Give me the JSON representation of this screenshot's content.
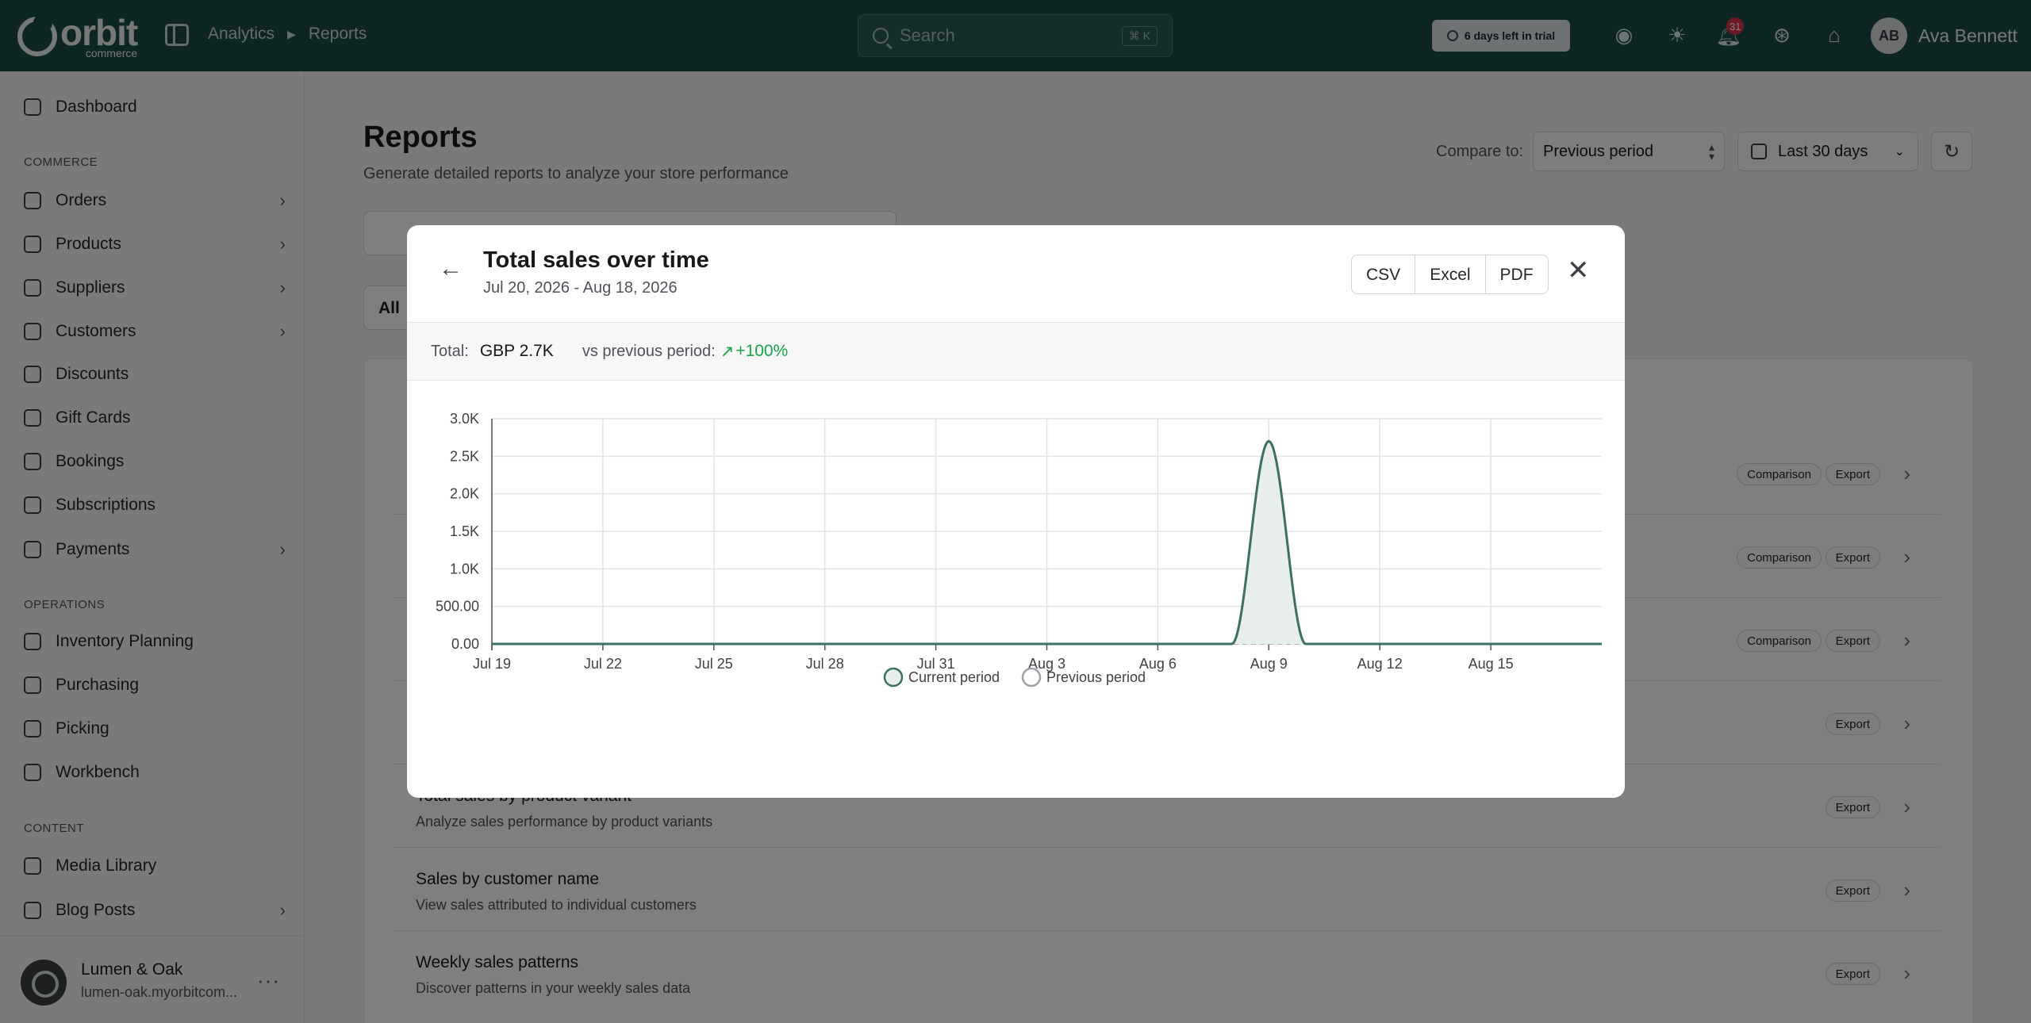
{
  "topbar": {
    "brand": "orbit",
    "brand_sub": "commerce",
    "breadcrumbs": [
      "Analytics",
      "Reports"
    ],
    "search_placeholder": "Search",
    "search_shortcut": "⌘ K",
    "trial_text": "6 days left in trial",
    "notification_count": "31",
    "user_initials": "AB",
    "user_name": "Ava Bennett"
  },
  "sidebar": {
    "dashboard": "Dashboard",
    "commerce_heading": "COMMERCE",
    "orders": "Orders",
    "products": "Products",
    "suppliers": "Suppliers",
    "customers": "Customers",
    "discounts": "Discounts",
    "gift_cards": "Gift Cards",
    "bookings": "Bookings",
    "subscriptions": "Subscriptions",
    "payments": "Payments",
    "operations_heading": "OPERATIONS",
    "inventory_planning": "Inventory Planning",
    "purchasing": "Purchasing",
    "picking": "Picking",
    "workbench": "Workbench",
    "content_heading": "CONTENT",
    "media_library": "Media Library",
    "blog_posts": "Blog Posts",
    "store_name": "Lumen & Oak",
    "store_url": "lumen-oak.myorbitcom..."
  },
  "page": {
    "title": "Reports",
    "subtitle": "Generate detailed reports to analyze your store performance",
    "compare_label": "Compare to:",
    "compare_value": "Previous period",
    "date_range": "Last 30 days",
    "filter_label": "All",
    "rows": [
      {
        "title": "",
        "desc": "",
        "tags": [
          "Comparison",
          "Export"
        ]
      },
      {
        "title": "",
        "desc": "",
        "tags": [
          "Comparison",
          "Export"
        ]
      },
      {
        "title": "",
        "desc": "",
        "tags": [
          "Comparison",
          "Export"
        ]
      },
      {
        "title": "",
        "desc": "",
        "tags": [
          "Export"
        ]
      },
      {
        "title": "Total sales by product variant",
        "desc": "Analyze sales performance by product variants",
        "tags": [
          "Export"
        ]
      },
      {
        "title": "Sales by customer name",
        "desc": "View sales attributed to individual customers",
        "tags": [
          "Export"
        ]
      },
      {
        "title": "Weekly sales patterns",
        "desc": "Discover patterns in your weekly sales data",
        "tags": [
          "Export"
        ]
      }
    ]
  },
  "modal": {
    "title": "Total sales over time",
    "date_range": "Jul 20, 2026 - Aug 18, 2026",
    "export_csv": "CSV",
    "export_excel": "Excel",
    "export_pdf": "PDF",
    "total_label": "Total:",
    "total_value": "GBP 2.7K",
    "vs_label": "vs previous period:",
    "vs_value": "+100%"
  },
  "colors": {
    "topbar": "#1d4d47",
    "line": "#3d6f65",
    "area": "#e8eeec",
    "trend_up": "#16a34a"
  },
  "chart_data": {
    "type": "area",
    "x": [
      "Jul 19",
      "Jul 20",
      "Jul 21",
      "Jul 22",
      "Jul 23",
      "Jul 24",
      "Jul 25",
      "Jul 26",
      "Jul 27",
      "Jul 28",
      "Jul 29",
      "Jul 30",
      "Jul 31",
      "Aug 1",
      "Aug 2",
      "Aug 3",
      "Aug 4",
      "Aug 5",
      "Aug 6",
      "Aug 7",
      "Aug 8",
      "Aug 9",
      "Aug 10",
      "Aug 11",
      "Aug 12",
      "Aug 13",
      "Aug 14",
      "Aug 15",
      "Aug 16",
      "Aug 17",
      "Aug 18"
    ],
    "x_ticks": [
      "Jul 19",
      "Jul 22",
      "Jul 25",
      "Jul 28",
      "Jul 31",
      "Aug 3",
      "Aug 6",
      "Aug 9",
      "Aug 12",
      "Aug 15"
    ],
    "series": [
      {
        "name": "Current period",
        "values": [
          0,
          0,
          0,
          0,
          0,
          0,
          0,
          0,
          0,
          0,
          0,
          0,
          0,
          0,
          0,
          0,
          0,
          0,
          0,
          0,
          0,
          2700,
          0,
          0,
          0,
          0,
          0,
          0,
          0,
          0,
          0
        ]
      },
      {
        "name": "Previous period",
        "values": [
          0,
          0,
          0,
          0,
          0,
          0,
          0,
          0,
          0,
          0,
          0,
          0,
          0,
          0,
          0,
          0,
          0,
          0,
          0,
          0,
          0,
          0,
          0,
          0,
          0,
          0,
          0,
          0,
          0,
          0,
          0
        ]
      }
    ],
    "y_ticks": [
      "0.00",
      "500.00",
      "1.0K",
      "1.5K",
      "2.0K",
      "2.5K",
      "3.0K"
    ],
    "ylim": [
      0,
      3000
    ],
    "grid": true,
    "legend_position": "bottom"
  }
}
